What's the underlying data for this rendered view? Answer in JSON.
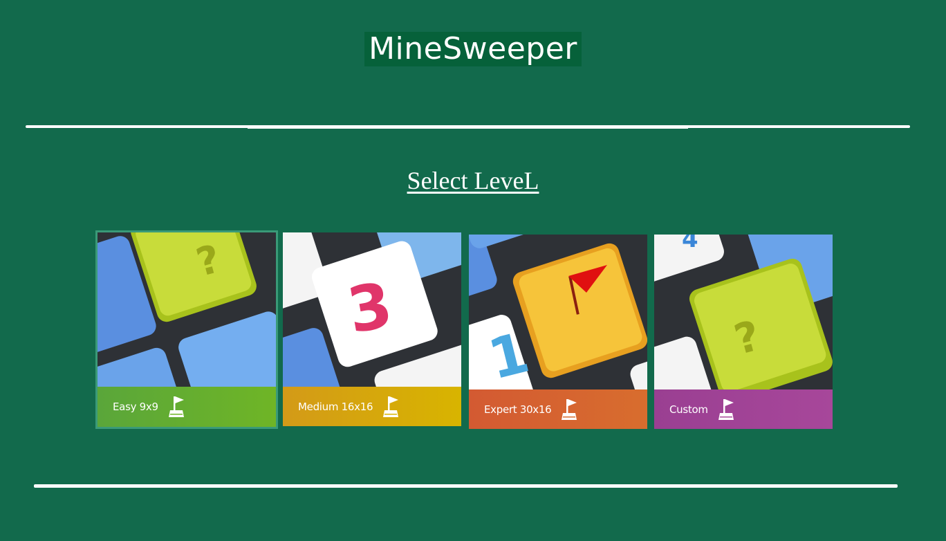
{
  "app": {
    "title": "MineSweeper"
  },
  "section": {
    "heading": "Select LeveL"
  },
  "levels": [
    {
      "label": "Easy 9x9",
      "color": "#5aa63a",
      "color2": "#6fb526",
      "art": "question",
      "icon": "flag-icon",
      "selected": true
    },
    {
      "label": "Medium 16x16",
      "color": "#d39a18",
      "color2": "#d8b400",
      "art": "three",
      "icon": "flag-icon",
      "selected": false
    },
    {
      "label": "Expert 30x16",
      "color": "#d35a32",
      "color2": "#d86d2e",
      "art": "redflag",
      "icon": "flag-icon",
      "selected": false
    },
    {
      "label": "Custom",
      "color": "#9a3f92",
      "color2": "#a7479a",
      "art": "question2",
      "icon": "flag-icon",
      "selected": false
    }
  ],
  "colors": {
    "background": "#126a4c",
    "title_bg": "#06613a",
    "text": "#ffffff"
  }
}
